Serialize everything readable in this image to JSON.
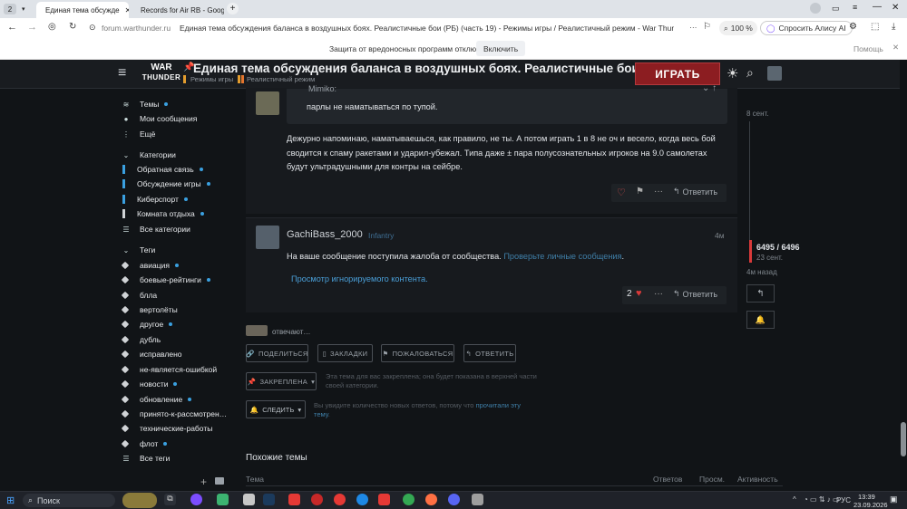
{
  "browser": {
    "tab_count": "2",
    "tabs": [
      {
        "label": "Единая тема обсужде",
        "active": true
      },
      {
        "label": "Records for Air RB - Goog",
        "active": false
      }
    ],
    "new_tab": "+",
    "url_host": "forum.warthunder.ru",
    "page_title": "Единая тема обсуждения баланса в воздушных боях. Реалистичные бои (РБ) (часть 19) - Режимы игры / Реалистичный режим - War Thunder — оф…",
    "zoom": "100 %",
    "alice": "Спросить Алису AI",
    "infobar_text": "Защита от вредоносных программ отключена",
    "infobar_button": "Включить",
    "infobar_help": "Помощь"
  },
  "site": {
    "logo_top": "WAR",
    "logo_bottom": "THUNDER",
    "title": "Единая тема обсуждения баланса в воздушных боях. Реалистичные бои (РБ…",
    "breadcrumb_1": "Режимы игры",
    "breadcrumb_2": "Реалистичный режим",
    "play_button": "ИГРАТЬ"
  },
  "sidebar": {
    "top": [
      {
        "label": "Темы",
        "icon": "layers-icon",
        "dot": true
      },
      {
        "label": "Мои сообщения",
        "icon": "user-icon",
        "dot": false
      },
      {
        "label": "Ещё",
        "icon": "more-icon",
        "dot": false
      }
    ],
    "categories_header": "Категории",
    "categories": [
      {
        "label": "Обратная связь",
        "color": "#3aa0e0",
        "dot": true
      },
      {
        "label": "Обсуждение игры",
        "color": "#3aa0e0",
        "dot": true
      },
      {
        "label": "Киберспорт",
        "color": "#3aa0e0",
        "dot": true
      },
      {
        "label": "Комната отдыха",
        "color": "#d0d3d6",
        "dot": true
      },
      {
        "label": "Все категории",
        "icon": "list-icon",
        "dot": false
      }
    ],
    "tags_header": "Теги",
    "tags": [
      {
        "label": "авиация",
        "dot": true
      },
      {
        "label": "боевые-рейтинги",
        "dot": true
      },
      {
        "label": "блла",
        "dot": false
      },
      {
        "label": "вертолёты",
        "dot": false
      },
      {
        "label": "другое",
        "dot": true
      },
      {
        "label": "дубль",
        "dot": false
      },
      {
        "label": "исправлено",
        "dot": false
      },
      {
        "label": "не-является-ошибкой",
        "dot": false
      },
      {
        "label": "новости",
        "dot": true
      },
      {
        "label": "обновление",
        "dot": true
      },
      {
        "label": "принято-к-рассмотрен…",
        "dot": false
      },
      {
        "label": "технические-работы",
        "dot": false
      },
      {
        "label": "флот",
        "dot": true
      },
      {
        "label": "Все теги",
        "icon": "list-icon",
        "dot": false
      }
    ]
  },
  "post1": {
    "quote_author": "Mimiko:",
    "quote_text": "парлы не наматываться по тупой.",
    "body": "Дежурно напоминаю, наматываешься, как правило, не ты. А потом играть 1 в 8 не оч и весело, когда весь бой сводится к спаму ракетами и ударил-убежал. Типа даже ± пара полусознательных игроков на 9.0 самолетах будут ультрадушными для контры на сейбре.",
    "reply": "Ответить"
  },
  "post2": {
    "author": "GachiBass_2000",
    "group": "Infantry",
    "time": "4м",
    "notice": "На ваше сообщение поступила жалоба от сообщества.",
    "notice_link": "Проверьте личные сообщения",
    "notice_end": ".",
    "ignored": "Просмотр игнорируемого контента.",
    "likes": "2",
    "reply": "Ответить"
  },
  "replying": "отвечают…",
  "actions": {
    "share": "ПОДЕЛИТЬСЯ",
    "bookmark": "ЗАКЛАДКИ",
    "flag": "ПОЖАЛОВАТЬСЯ",
    "reply": "ОТВЕТИТЬ"
  },
  "pinned": {
    "button": "ЗАКРЕПЛЕНА",
    "text": "Эта тема для вас закреплена; она будет показана в верхней части своей категории."
  },
  "watch": {
    "button": "СЛЕДИТЬ",
    "text": "Вы увидите количество новых ответов, потому что",
    "link": "прочитали эту тему",
    "end": "."
  },
  "similar": {
    "title": "Похожие темы",
    "col_topic": "Тема",
    "col_replies": "Ответов",
    "col_views": "Просм.",
    "col_activity": "Активность"
  },
  "timeline": {
    "top_date": "8 сент.",
    "counter": "6495 / 6496",
    "counter_date": "23 сент.",
    "last": "4м назад"
  },
  "taskbar": {
    "search": "Поиск",
    "lang": "РУС",
    "time": "13:39",
    "date": "23.09.2026"
  }
}
